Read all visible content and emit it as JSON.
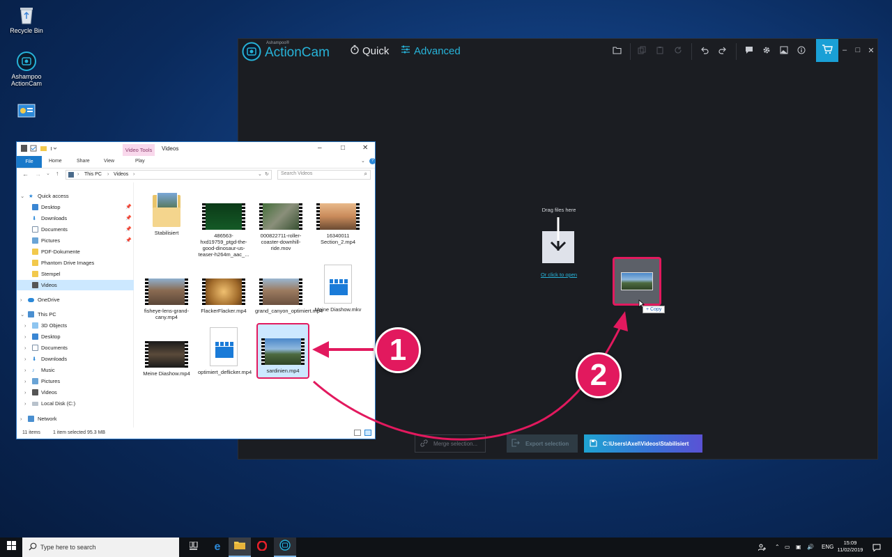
{
  "desktop": {
    "icons": [
      {
        "label": "Recycle Bin"
      },
      {
        "label": "Ashampoo ActionCam"
      },
      {
        "label": ""
      }
    ]
  },
  "actioncam": {
    "brand_small": "Ashampoo®",
    "brand": "ActionCam",
    "mode_quick": "Quick",
    "mode_advanced": "Advanced",
    "drop_label": "Drag files here",
    "open_link": "Or click to open",
    "copy_tooltip": "+ Copy",
    "merge_button": "Merge selection...",
    "export_button": "Export selection",
    "output_path": "C:\\Users\\Axel\\Videos\\Stabilisiert",
    "colors": {
      "accent": "#27b3d9",
      "bg": "#1b1d22",
      "cart": "#1aa0d6"
    }
  },
  "explorer": {
    "title": "Videos",
    "context_tab": "Video Tools",
    "context_sub": "Play",
    "ribbon_tabs": [
      "File",
      "Home",
      "Share",
      "View"
    ],
    "breadcrumb": [
      "This PC",
      "Videos"
    ],
    "search_placeholder": "Search Videos",
    "nav": {
      "quick_access": "Quick access",
      "quick_items": [
        "Desktop",
        "Downloads",
        "Documents",
        "Pictures",
        "PDF-Dokumente",
        "Phantom Drive Images",
        "Stempel",
        "Videos"
      ],
      "onedrive": "OneDrive",
      "this_pc": "This PC",
      "pc_items": [
        "3D Objects",
        "Desktop",
        "Documents",
        "Downloads",
        "Music",
        "Pictures",
        "Videos",
        "Local Disk (C:)"
      ],
      "network": "Network"
    },
    "files": [
      {
        "name": "Stabilisiert",
        "kind": "folder"
      },
      {
        "name": "486563-hxd19759_ptgd-the-good-dinosaur-us-teaser-h264m_aac_...",
        "kind": "video-green"
      },
      {
        "name": "000822711-roller-coaster-downhill-ride.mov",
        "kind": "video-rail"
      },
      {
        "name": "16340011 Section_2.mp4",
        "kind": "video-sunset"
      },
      {
        "name": "fisheye-lens-grand-cany.mp4",
        "kind": "video-canyon"
      },
      {
        "name": "FlackerFlacker.mp4",
        "kind": "video-orange"
      },
      {
        "name": "grand_canyon_optimiert.mp4",
        "kind": "video-canyon"
      },
      {
        "name": "Meine Diashow.mkv",
        "kind": "clapper"
      },
      {
        "name": "Meine Diashow.mp4",
        "kind": "video-dark"
      },
      {
        "name": "optimiert_deflicker.mp4",
        "kind": "clapper"
      },
      {
        "name": "sardinien.mp4",
        "kind": "video-mountain"
      }
    ],
    "status_count": "11 items",
    "status_selected": "1 item selected  95.3 MB"
  },
  "taskbar": {
    "search_placeholder": "Type here to search",
    "language": "ENG",
    "time": "15:09",
    "date": "11/02/2019"
  },
  "annotations": [
    "1",
    "2"
  ]
}
